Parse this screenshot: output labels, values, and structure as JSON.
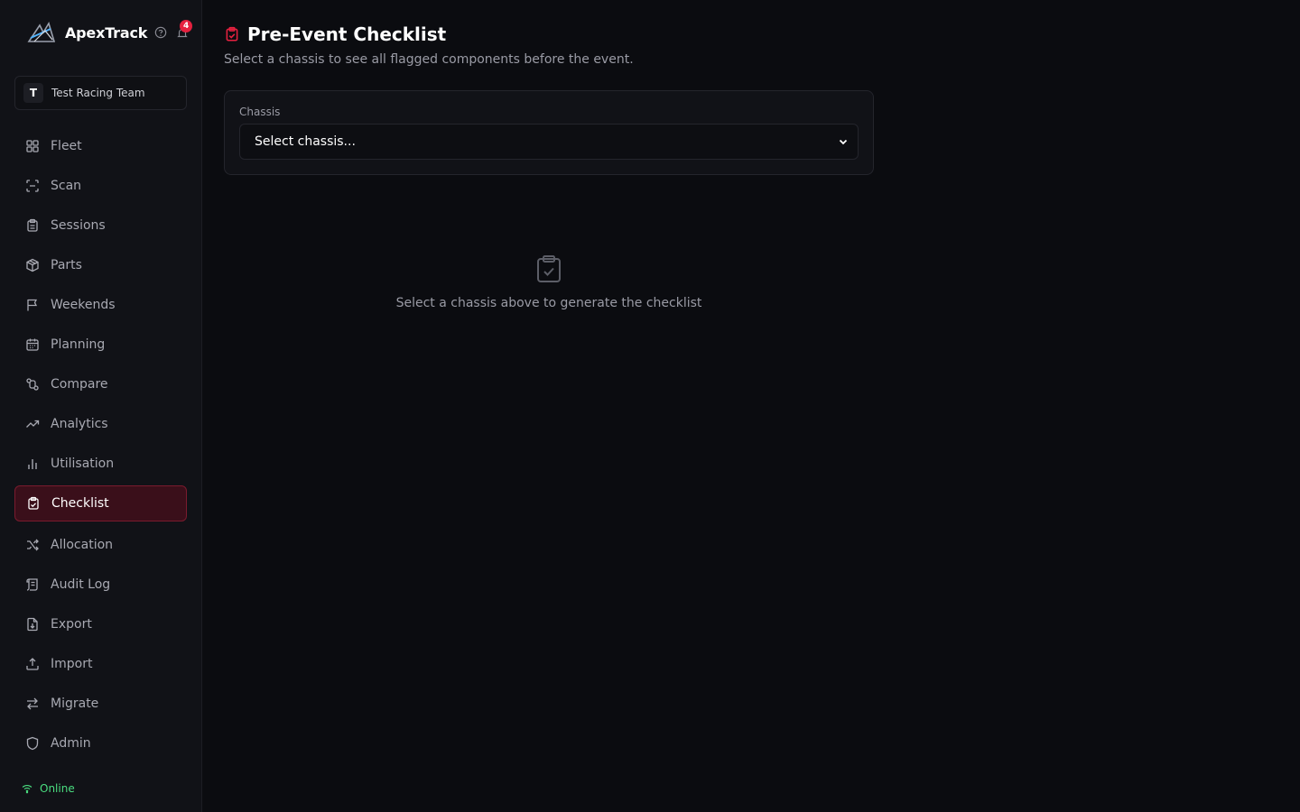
{
  "app": {
    "name": "ApexTrack",
    "notification_count": "4",
    "team_initial": "T",
    "team_name": "Test Racing Team"
  },
  "colors": {
    "accent": "#e5213f",
    "active_bg": "#3a0f1a",
    "online": "#4ade80",
    "background": "#0b0c10"
  },
  "nav": [
    {
      "label": "Fleet",
      "icon": "grid-icon"
    },
    {
      "label": "Scan",
      "icon": "scan-icon"
    },
    {
      "label": "Sessions",
      "icon": "clipboard-icon"
    },
    {
      "label": "Parts",
      "icon": "package-icon"
    },
    {
      "label": "Weekends",
      "icon": "flag-icon"
    },
    {
      "label": "Planning",
      "icon": "calendar-icon"
    },
    {
      "label": "Compare",
      "icon": "compare-icon"
    },
    {
      "label": "Analytics",
      "icon": "trending-up-icon"
    },
    {
      "label": "Utilisation",
      "icon": "bar-chart-icon"
    },
    {
      "label": "Checklist",
      "icon": "clipboard-check-icon",
      "active": true
    },
    {
      "label": "Allocation",
      "icon": "shuffle-icon"
    },
    {
      "label": "Audit Log",
      "icon": "scroll-icon"
    },
    {
      "label": "Export",
      "icon": "file-download-icon"
    },
    {
      "label": "Import",
      "icon": "upload-icon"
    },
    {
      "label": "Migrate",
      "icon": "arrows-left-right-icon"
    },
    {
      "label": "Admin",
      "icon": "shield-icon"
    }
  ],
  "status": {
    "label": "Online"
  },
  "page": {
    "title": "Pre-Event Checklist",
    "subtitle": "Select a chassis to see all flagged components before the event."
  },
  "form": {
    "chassis_label": "Chassis",
    "chassis_value": "Select chassis..."
  },
  "empty_state": {
    "message": "Select a chassis above to generate the checklist"
  }
}
